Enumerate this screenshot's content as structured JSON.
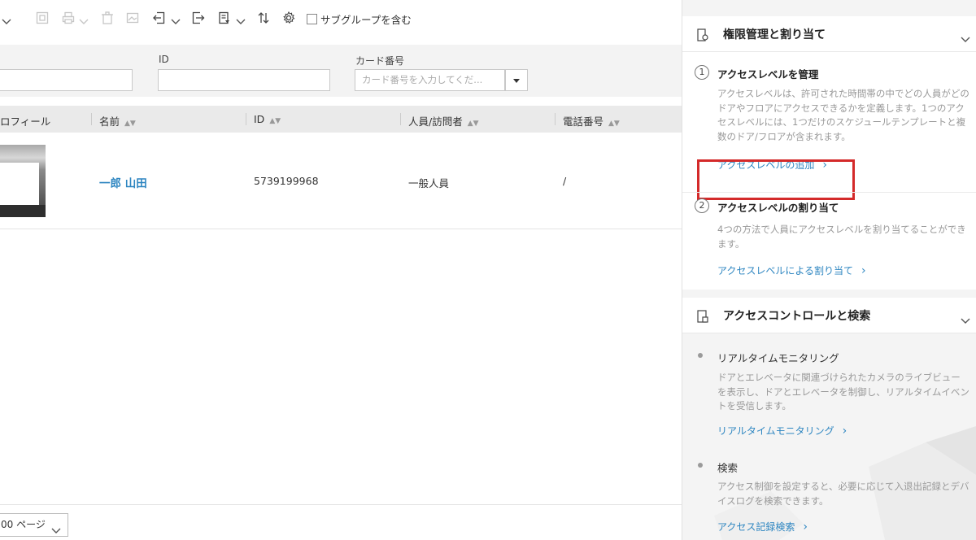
{
  "toolbar": {
    "subgroup_label": "サブグループを含む"
  },
  "filters": {
    "id_label": "ID",
    "card_label": "カード番号",
    "card_placeholder": "カード番号を入力してくだ..."
  },
  "table": {
    "headers": [
      "ロフィール",
      "名前",
      "ID",
      "人員/訪問者",
      "電話番号"
    ],
    "rows": [
      {
        "name": "一郎 山田",
        "id": "5739199968",
        "type": "一般人員",
        "phone": "/"
      }
    ]
  },
  "pagination": {
    "per_page": "00 ページ"
  },
  "guide": {
    "section1": {
      "title": "権限管理と割り当て",
      "steps": [
        {
          "num": "1",
          "title": "アクセスレベルを管理",
          "desc": "アクセスレベルは、許可された時間帯の中でどの人員がどのドアやフロアにアクセスできるかを定義します。1つのアクセスレベルには、1つだけのスケジュールテンプレートと複数のドア/フロアが含まれます。",
          "link": "アクセスレベルの追加"
        },
        {
          "num": "2",
          "title": "アクセスレベルの割り当て",
          "desc": "4つの方法で人員にアクセスレベルを割り当てることができます。",
          "link": "アクセスレベルによる割り当て"
        }
      ]
    },
    "section2": {
      "title": "アクセスコントロールと検索",
      "items": [
        {
          "title": "リアルタイムモニタリング",
          "desc": "ドアとエレベータに関連づけられたカメラのライブビューを表示し、ドアとエレベータを制御し、リアルタイムイベントを受信します。",
          "link": "リアルタイムモニタリング"
        },
        {
          "title": "検索",
          "desc": "アクセス制御を設定すると、必要に応じて入退出記録とデバイスログを検索できます。",
          "link": "アクセス記録検索"
        }
      ]
    }
  },
  "colors": {
    "link": "#2e86c1",
    "highlight_box": "#d42a2a"
  }
}
